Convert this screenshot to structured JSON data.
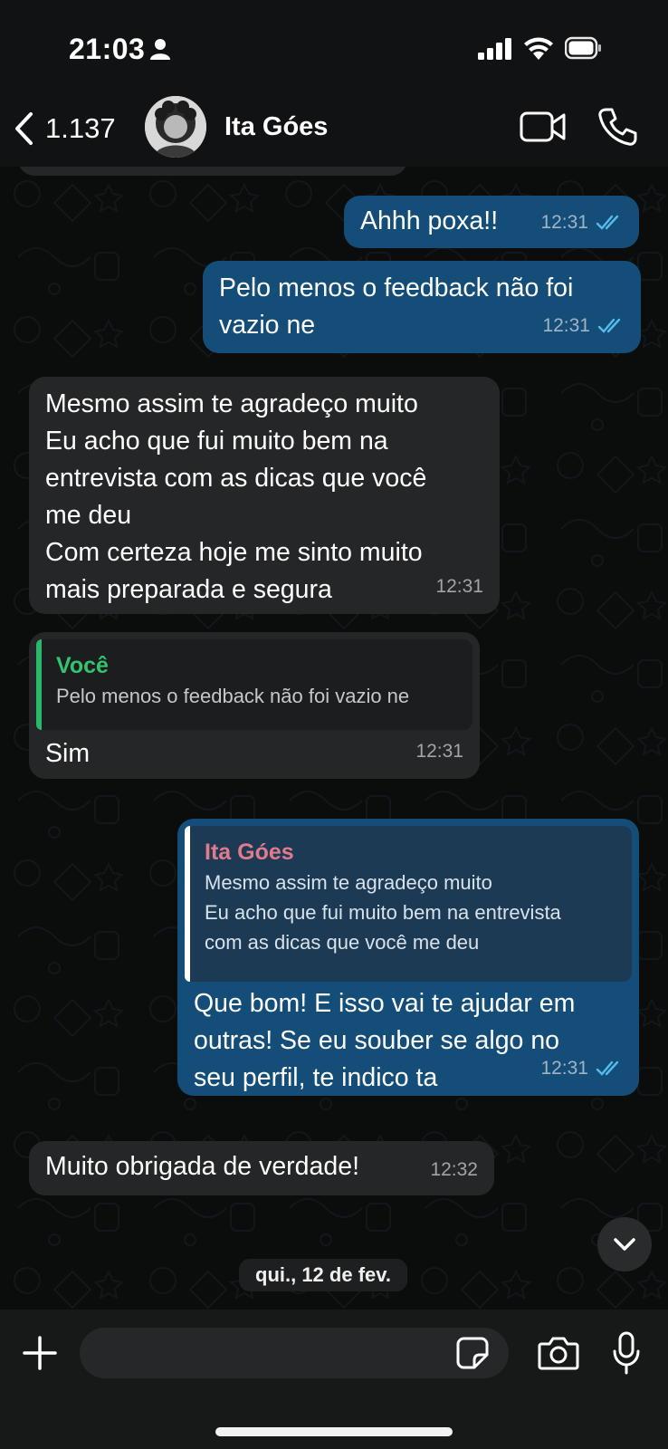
{
  "status_bar": {
    "time": "21:03",
    "icons": [
      "person-icon",
      "signal-icon",
      "wifi-icon",
      "battery-icon"
    ]
  },
  "header": {
    "back_count": "1.137",
    "contact_name": "Ita Góes",
    "icons": [
      "chevron-left-icon",
      "video-camera-icon",
      "phone-icon"
    ]
  },
  "messages": [
    {
      "dir": "out",
      "text": "Ahhh poxa!!",
      "time": "12:31",
      "status": "read"
    },
    {
      "dir": "out",
      "text": "Pelo menos o feedback não foi vazio ne",
      "time": "12:31",
      "status": "read"
    },
    {
      "dir": "in",
      "lines": [
        "Mesmo assim te agradeço muito",
        "Eu acho que fui muito bem na",
        "entrevista com as dicas que você",
        "me deu",
        "Com certeza hoje me sinto muito",
        "mais preparada e segura"
      ],
      "time": "12:31"
    },
    {
      "dir": "in",
      "quote": {
        "author": "Você",
        "text": "Pelo menos o feedback não foi vazio ne"
      },
      "text": "Sim",
      "time": "12:31"
    },
    {
      "dir": "out",
      "quote": {
        "author": "Ita Góes",
        "lines": [
          "Mesmo assim te agradeço muito",
          "Eu acho que fui muito bem na entrevista",
          "com as dicas que você me deu"
        ]
      },
      "lines": [
        "Que bom! E isso vai te ajudar em",
        "outras! Se eu souber se algo no",
        "seu perfil, te indico ta"
      ],
      "time": "12:31",
      "status": "read"
    },
    {
      "dir": "in",
      "text": "Muito obrigada de verdade!",
      "time": "12:32"
    }
  ],
  "date_separator": "qui., 12 de fev.",
  "input": {
    "placeholder": "",
    "value": ""
  },
  "colors": {
    "outgoing_bubble": "#144d78",
    "incoming_bubble": "#252627",
    "quote_you": "#34c36f",
    "quote_contact": "#e07b8c",
    "read_tick": "#53bdeb"
  }
}
